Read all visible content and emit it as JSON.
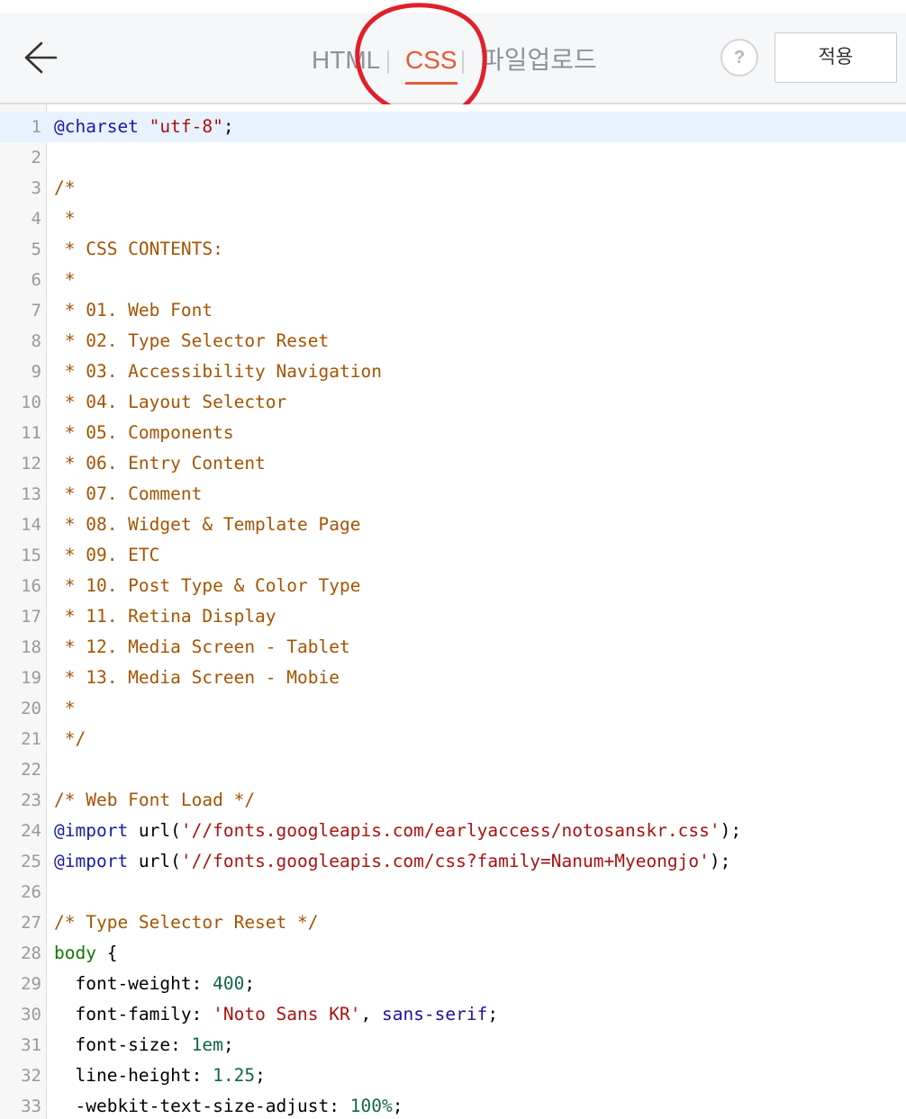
{
  "header": {
    "tabs": [
      {
        "label": "HTML",
        "active": false
      },
      {
        "label": "CSS",
        "active": true
      },
      {
        "label": "파일업로드",
        "active": false
      }
    ],
    "help_label": "?",
    "apply_label": "적용",
    "icons": {
      "back": "arrow-left-icon",
      "help": "question-icon"
    },
    "colors": {
      "active_tab": "#e75a36",
      "inactive_tab": "#8e9297",
      "annotation": "#e0202a"
    }
  },
  "editor": {
    "active_line": 1,
    "lines": [
      {
        "n": "1",
        "tokens": [
          {
            "t": "def",
            "v": "@charset "
          },
          {
            "t": "string",
            "v": "\"utf-8\""
          },
          {
            "t": "plain",
            "v": ";"
          }
        ]
      },
      {
        "n": "2",
        "tokens": []
      },
      {
        "n": "3",
        "tokens": [
          {
            "t": "comment",
            "v": "/*"
          }
        ]
      },
      {
        "n": "4",
        "tokens": [
          {
            "t": "comment",
            "v": " *"
          }
        ]
      },
      {
        "n": "5",
        "tokens": [
          {
            "t": "comment",
            "v": " * CSS CONTENTS:"
          }
        ]
      },
      {
        "n": "6",
        "tokens": [
          {
            "t": "comment",
            "v": " *"
          }
        ]
      },
      {
        "n": "7",
        "tokens": [
          {
            "t": "comment",
            "v": " * 01. Web Font"
          }
        ]
      },
      {
        "n": "8",
        "tokens": [
          {
            "t": "comment",
            "v": " * 02. Type Selector Reset"
          }
        ]
      },
      {
        "n": "9",
        "tokens": [
          {
            "t": "comment",
            "v": " * 03. Accessibility Navigation"
          }
        ]
      },
      {
        "n": "10",
        "tokens": [
          {
            "t": "comment",
            "v": " * 04. Layout Selector"
          }
        ]
      },
      {
        "n": "11",
        "tokens": [
          {
            "t": "comment",
            "v": " * 05. Components"
          }
        ]
      },
      {
        "n": "12",
        "tokens": [
          {
            "t": "comment",
            "v": " * 06. Entry Content"
          }
        ]
      },
      {
        "n": "13",
        "tokens": [
          {
            "t": "comment",
            "v": " * 07. Comment"
          }
        ]
      },
      {
        "n": "14",
        "tokens": [
          {
            "t": "comment",
            "v": " * 08. Widget & Template Page"
          }
        ]
      },
      {
        "n": "15",
        "tokens": [
          {
            "t": "comment",
            "v": " * 09. ETC"
          }
        ]
      },
      {
        "n": "16",
        "tokens": [
          {
            "t": "comment",
            "v": " * 10. Post Type & Color Type"
          }
        ]
      },
      {
        "n": "17",
        "tokens": [
          {
            "t": "comment",
            "v": " * 11. Retina Display"
          }
        ]
      },
      {
        "n": "18",
        "tokens": [
          {
            "t": "comment",
            "v": " * 12. Media Screen - Tablet"
          }
        ]
      },
      {
        "n": "19",
        "tokens": [
          {
            "t": "comment",
            "v": " * 13. Media Screen - Mobie"
          }
        ]
      },
      {
        "n": "20",
        "tokens": [
          {
            "t": "comment",
            "v": " *"
          }
        ]
      },
      {
        "n": "21",
        "tokens": [
          {
            "t": "comment",
            "v": " */"
          }
        ]
      },
      {
        "n": "22",
        "tokens": []
      },
      {
        "n": "23",
        "tokens": [
          {
            "t": "comment",
            "v": "/* Web Font Load */"
          }
        ]
      },
      {
        "n": "24",
        "tokens": [
          {
            "t": "def",
            "v": "@import"
          },
          {
            "t": "plain",
            "v": " url("
          },
          {
            "t": "string",
            "v": "'//fonts.googleapis.com/earlyaccess/notosanskr.css'"
          },
          {
            "t": "plain",
            "v": ");"
          }
        ]
      },
      {
        "n": "25",
        "tokens": [
          {
            "t": "def",
            "v": "@import"
          },
          {
            "t": "plain",
            "v": " url("
          },
          {
            "t": "string",
            "v": "'//fonts.googleapis.com/css?family=Nanum+Myeongjo'"
          },
          {
            "t": "plain",
            "v": ");"
          }
        ]
      },
      {
        "n": "26",
        "tokens": []
      },
      {
        "n": "27",
        "tokens": [
          {
            "t": "comment",
            "v": "/* Type Selector Reset */"
          }
        ]
      },
      {
        "n": "28",
        "tokens": [
          {
            "t": "tag",
            "v": "body"
          },
          {
            "t": "plain",
            "v": " {"
          }
        ]
      },
      {
        "n": "29",
        "tokens": [
          {
            "t": "prop",
            "v": "  font-weight"
          },
          {
            "t": "plain",
            "v": ": "
          },
          {
            "t": "num",
            "v": "400"
          },
          {
            "t": "plain",
            "v": ";"
          }
        ]
      },
      {
        "n": "30",
        "tokens": [
          {
            "t": "prop",
            "v": "  font-family"
          },
          {
            "t": "plain",
            "v": ": "
          },
          {
            "t": "string",
            "v": "'Noto Sans KR'"
          },
          {
            "t": "plain",
            "v": ", "
          },
          {
            "t": "atom",
            "v": "sans-serif"
          },
          {
            "t": "plain",
            "v": ";"
          }
        ]
      },
      {
        "n": "31",
        "tokens": [
          {
            "t": "prop",
            "v": "  font-size"
          },
          {
            "t": "plain",
            "v": ": "
          },
          {
            "t": "num",
            "v": "1em"
          },
          {
            "t": "plain",
            "v": ";"
          }
        ]
      },
      {
        "n": "32",
        "tokens": [
          {
            "t": "prop",
            "v": "  line-height"
          },
          {
            "t": "plain",
            "v": ": "
          },
          {
            "t": "num",
            "v": "1.25"
          },
          {
            "t": "plain",
            "v": ";"
          }
        ]
      },
      {
        "n": "33",
        "tokens": [
          {
            "t": "prop",
            "v": "  -webkit-text-size-adjust"
          },
          {
            "t": "plain",
            "v": ": "
          },
          {
            "t": "num",
            "v": "100%"
          },
          {
            "t": "plain",
            "v": ";"
          }
        ]
      }
    ]
  }
}
